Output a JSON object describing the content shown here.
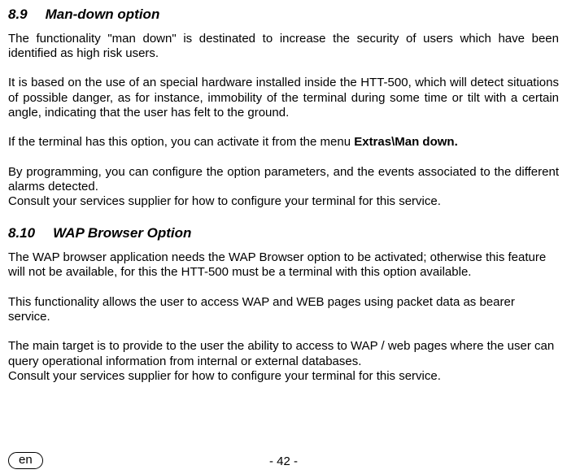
{
  "section1": {
    "number": "8.9",
    "title": "Man-down option",
    "p1": "The functionality \"man down\" is destinated to increase the security of users which have been identified as high risk users.",
    "p2": "It is based on the use of an special hardware installed inside the HTT-500, which will detect situations of possible danger, as for instance, immobility of the terminal during some time or tilt with a certain angle, indicating that the user has felt to the ground.",
    "p3a": "If the terminal has this option, you can activate it from the menu ",
    "p3b": "Extras\\Man down.",
    "p4": "By programming, you can configure the option parameters, and the events associated to the different alarms detected.",
    "p5": "Consult your services supplier for how to configure your terminal for this service."
  },
  "section2": {
    "number": "8.10",
    "title": "WAP Browser Option",
    "p1": "The WAP browser application needs the WAP Browser option to be activated; otherwise this feature will not be available, for this the HTT-500 must be a terminal with this option available.",
    "p2": "This functionality allows the user to access WAP and WEB pages using packet data as bearer service.",
    "p3": "The main target is to provide to the user the ability to access to WAP / web pages where the user can query operational information from internal or external databases.",
    "p4": "Consult your services supplier for how to configure your terminal for this service."
  },
  "footer": {
    "page": "- 42 -",
    "lang": "en"
  }
}
